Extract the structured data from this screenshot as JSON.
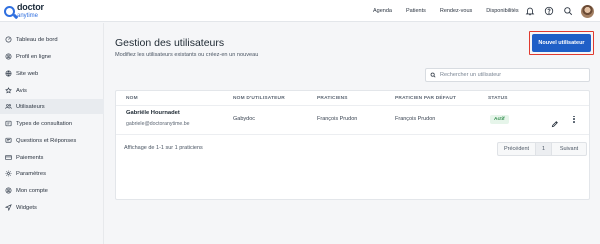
{
  "brand": {
    "name": "doctor",
    "tagline": "anytime"
  },
  "topnav": {
    "items": [
      "Agenda",
      "Patients",
      "Rendez-vous",
      "Disponibilités"
    ],
    "icons": [
      "bell-icon",
      "help-icon",
      "search-icon",
      "avatar"
    ]
  },
  "sidebar": {
    "items": [
      {
        "label": "Tableau de bord",
        "icon": "dashboard-icon",
        "active": false
      },
      {
        "label": "Profil en ligne",
        "icon": "user-circle-icon",
        "active": false
      },
      {
        "label": "Site web",
        "icon": "globe-icon",
        "active": false
      },
      {
        "label": "Avis",
        "icon": "star-icon",
        "active": false
      },
      {
        "label": "Utilisateurs",
        "icon": "users-icon",
        "active": true
      },
      {
        "label": "Types de consultation",
        "icon": "consultation-icon",
        "active": false
      },
      {
        "label": "Questions et Réponses",
        "icon": "qa-icon",
        "active": false
      },
      {
        "label": "Paiements",
        "icon": "credit-card-icon",
        "active": false
      },
      {
        "label": "Paramètres",
        "icon": "gear-icon",
        "active": false
      },
      {
        "label": "Mon compte",
        "icon": "account-icon",
        "active": false
      },
      {
        "label": "Widgets",
        "icon": "send-icon",
        "active": false
      }
    ]
  },
  "page": {
    "title": "Gestion des utilisateurs",
    "subtitle": "Modifiez les utilisateurs existants ou créez-en un nouveau",
    "new_user_button": "Nouvel utilisateur",
    "search_placeholder": "Rechercher un utilisateur"
  },
  "table": {
    "columns": [
      "NOM",
      "NOM D'UTILISATEUR",
      "PRATICIENS",
      "PRATICIEN PAR DÉFAUT",
      "STATUS"
    ],
    "rows": [
      {
        "name": "Gabriële Hournadet",
        "email": "gabriele@doctoranytime.be",
        "username": "Gabydoc",
        "practitioners": "François Prudon",
        "default_practitioner": "François Prudon",
        "status": "Actif"
      }
    ]
  },
  "pagination": {
    "info": "Affichage de 1-1 sur 1 praticiens",
    "previous": "Précédent",
    "page": "1",
    "next": "Suivant"
  },
  "colors": {
    "primary": "#1f5fc7",
    "highlight_outline": "#e03a2f",
    "status_active_bg": "#e6f5ea",
    "status_active_text": "#2e8b4a",
    "brand_blue": "#2f6fdf"
  }
}
